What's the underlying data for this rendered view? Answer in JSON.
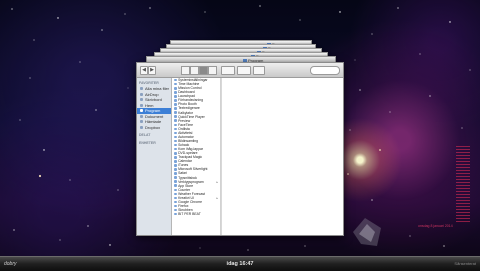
{
  "menubar": {
    "left_text": "dobry",
    "clock": "idag 16:47",
    "right_text": "Sånsenterat"
  },
  "finder": {
    "stack_label": "Program",
    "sidebar": {
      "sections": [
        {
          "label": "FAVORITER",
          "items": [
            {
              "label": "Alla mina filer"
            },
            {
              "label": "AirDrop"
            },
            {
              "label": "Skrivbord"
            },
            {
              "label": "Hem"
            },
            {
              "label": "Program",
              "selected": true
            },
            {
              "label": "Dokument"
            },
            {
              "label": "Hämtade"
            },
            {
              "label": "Dropbox"
            }
          ]
        },
        {
          "label": "DELAT",
          "items": []
        },
        {
          "label": "ENHETER",
          "items": []
        }
      ]
    },
    "apps": [
      "Systeminställningar",
      "Time Machine",
      "Mission Control",
      "Dashboard",
      "Launchpad",
      "Förhandsvisning",
      "Photo Booth",
      "Textredigerare",
      "Kalkylator",
      "QuickTime Player",
      "Preview",
      "FaceTime",
      "Ordlista",
      "Aktivitetsl",
      "Automator",
      "Bildinsamling",
      "Schack",
      "Kom ihåg-lappar",
      "DVD-spelare",
      "Trackpad Magic",
      "Calendar",
      "iTunes",
      "Microsoft Silverlight",
      "Safari",
      "Typsnittsbok",
      "Verktygsprogram",
      "App Store",
      "Counter",
      "Weather Forecast",
      "Kreativt UI",
      "Google Chrome",
      "Firefox",
      "Skrubben",
      "BIT PER BEAT"
    ]
  },
  "widget": {
    "label": "onsdag 8 januari 2014"
  }
}
